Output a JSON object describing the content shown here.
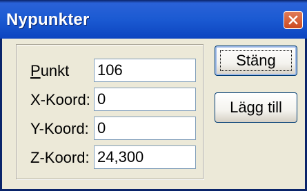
{
  "window": {
    "title": "Nypunkter"
  },
  "icons": {
    "close": "close-icon"
  },
  "fields": [
    {
      "label": "Punkt",
      "access_key_index": 0,
      "value": "106"
    },
    {
      "label": "X-Koord:",
      "access_key_index": -1,
      "value": "0"
    },
    {
      "label": "Y-Koord:",
      "access_key_index": -1,
      "value": "0"
    },
    {
      "label": "Z-Koord:",
      "access_key_index": -1,
      "value": "24,300"
    }
  ],
  "buttons": {
    "close_label": "Stäng",
    "add_label": "Lägg till"
  },
  "colors": {
    "titlebar": "#1b5ad2",
    "window_bg": "#ece9d8",
    "close_button": "#cc4a20",
    "button_border": "#003c74"
  }
}
